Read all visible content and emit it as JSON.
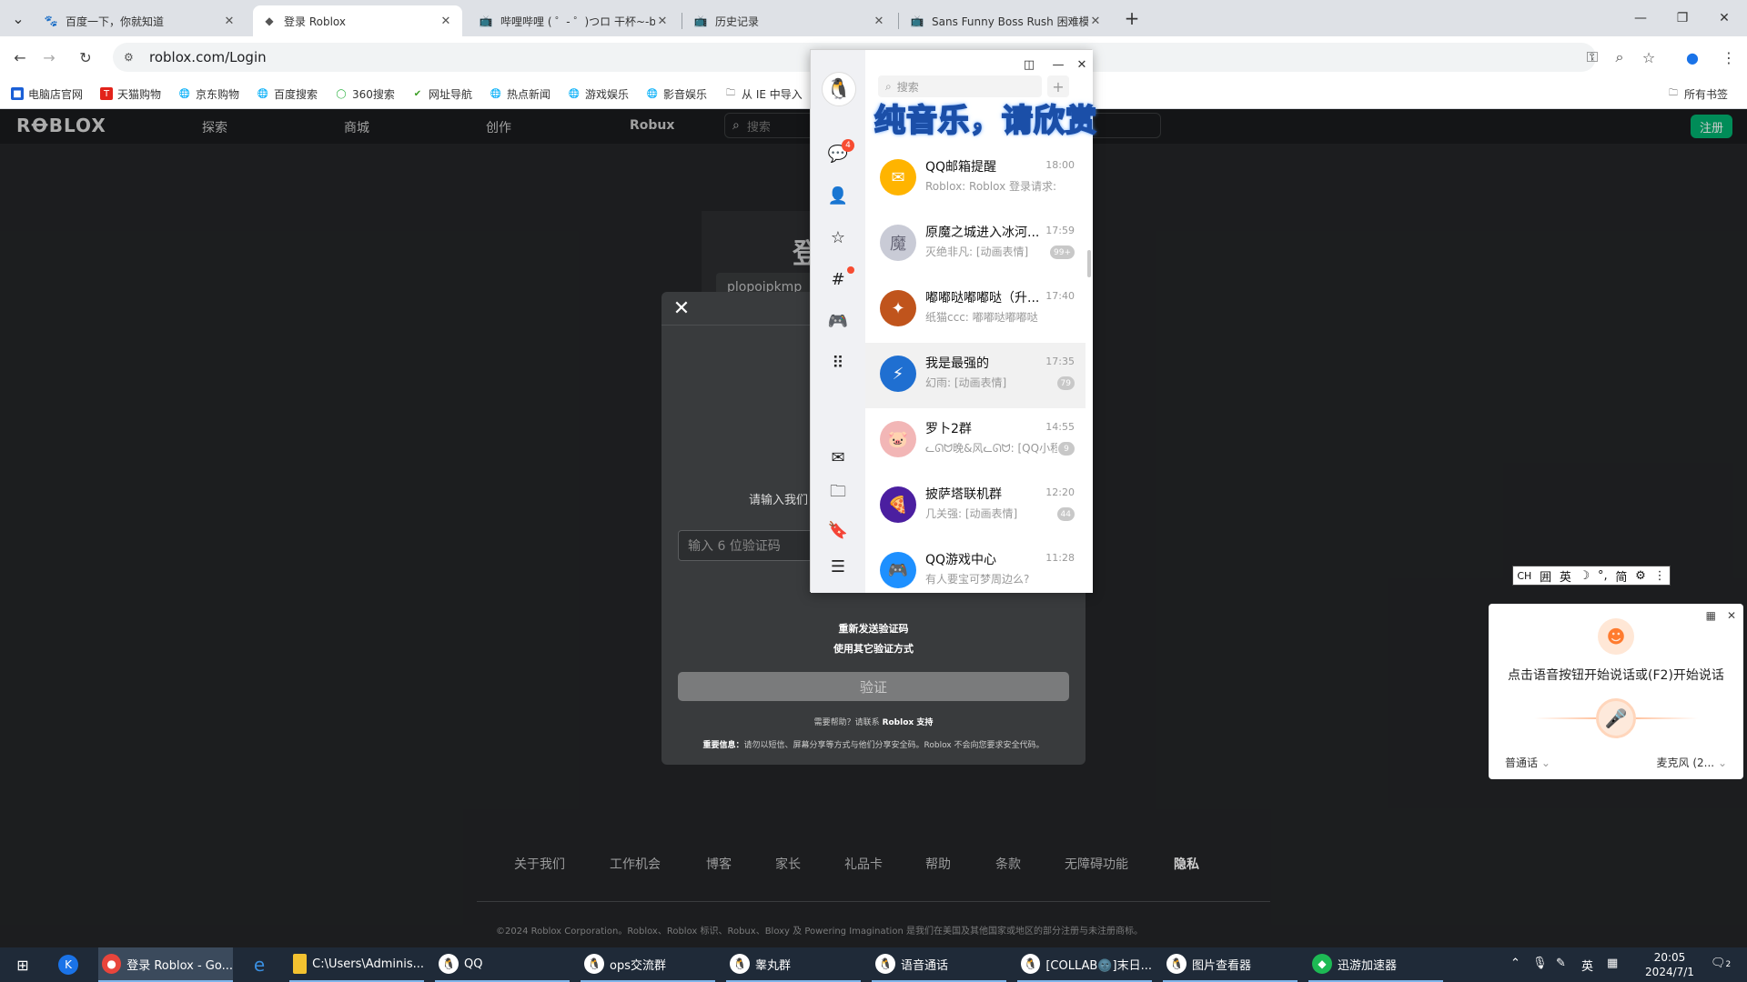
{
  "browser": {
    "tabs": [
      {
        "label": "百度一下，你就知道",
        "icon": "baidu-paw-icon",
        "active": false
      },
      {
        "label": "登录 Roblox",
        "icon": "roblox-icon",
        "active": true
      },
      {
        "label": "哔哩哔哩 ( ゜- ゜)つロ 干杯~-bili",
        "icon": "bilibili-tv-icon",
        "active": false
      },
      {
        "label": "历史记录",
        "icon": "bilibili-tv-icon",
        "active": false
      },
      {
        "label": "Sans Funny Boss Rush 困难模式",
        "icon": "bilibili-tv-icon",
        "active": false
      }
    ],
    "url": "roblox.com/Login",
    "bookmarks": [
      {
        "label": "电脑店官网",
        "color": "#1a5fd6"
      },
      {
        "label": "天猫购物",
        "color": "#e2231a"
      },
      {
        "label": "京东购物",
        "color": "#555555"
      },
      {
        "label": "百度搜索",
        "color": "#555555"
      },
      {
        "label": "360搜索",
        "color": "#2fb344"
      },
      {
        "label": "网址导航",
        "color": "#3a9d23"
      },
      {
        "label": "热点新闻",
        "color": "#555555"
      },
      {
        "label": "游戏娱乐",
        "color": "#555555"
      },
      {
        "label": "影音娱乐",
        "color": "#555555"
      },
      {
        "label": "从 IE 中导入",
        "color": "#555555"
      }
    ],
    "all_bookmarks": "所有书签"
  },
  "roblox": {
    "logo": "RꝊBLOX",
    "nav": [
      "探索",
      "商城",
      "创作",
      "Robux"
    ],
    "search_placeholder": "搜索",
    "signup": "注册",
    "login_title": "登",
    "username": "plopoipkmp",
    "verify": {
      "prompt": "请输入我们",
      "input_placeholder": "输入 6 位验证码",
      "resend": "重新发送验证码",
      "other_method": "使用其它验证方式",
      "button": "验证",
      "help_prefix": "需要帮助？请联系",
      "help_link": "Roblox 支持",
      "warning_prefix": "重要信息：",
      "warning_text": "请勿以短信、屏幕分享等方式与他们分享安全码。Roblox 不会向您要求安全代码。"
    },
    "footer": [
      "关于我们",
      "工作机会",
      "博客",
      "家长",
      "礼品卡",
      "帮助",
      "条款",
      "无障碍功能",
      "隐私"
    ],
    "copyright": "©2024 Roblox Corporation。Roblox、Roblox 标识、Robux、Bloxy 及 Powering Imagination 是我们在美国及其他国家或地区的部分注册与未注册商标。"
  },
  "qq": {
    "search_placeholder": "搜索",
    "banner": "纯音乐，请欣赏",
    "chat_badge": "4",
    "conversations": [
      {
        "name": "QQ邮箱提醒",
        "time": "18:00",
        "preview": "Roblox: Roblox 登录请求: ...",
        "badge": "",
        "avatar_color": "#ffb400",
        "avatar_icon": "mail-icon"
      },
      {
        "name": "原魔之城进入冰河...",
        "time": "17:59",
        "preview": "灭绝非凡: [动画表情]",
        "badge": "99+",
        "avatar_color": "#c9cbd6",
        "avatar_icon": "group-icon"
      },
      {
        "name": "嘟嘟哒嘟嘟哒（升...",
        "time": "17:40",
        "preview": "纸猫ccc: 嘟嘟哒嘟嘟哒",
        "badge": "",
        "avatar_color": "#c0541c",
        "avatar_icon": "group-icon"
      },
      {
        "name": "我是最强的",
        "time": "17:35",
        "preview": "幻雨: [动画表情]",
        "badge": "79",
        "avatar_color": "#1f6fd1",
        "avatar_icon": "group-icon"
      },
      {
        "name": "罗卜2群",
        "time": "14:55",
        "preview": "ᓚᘏᗢ晚&风ᓚᘏᗢ: [QQ小程...",
        "badge": "9",
        "avatar_color": "#f2b6b6",
        "avatar_icon": "pig-icon"
      },
      {
        "name": "披萨塔联机群",
        "time": "12:20",
        "preview": "几关强: [动画表情]",
        "badge": "44",
        "avatar_color": "#4b1fa0",
        "avatar_icon": "group-icon"
      },
      {
        "name": "QQ游戏中心",
        "time": "11:28",
        "preview": "有人要宝可梦周边么?",
        "badge": "",
        "avatar_color": "#1e90ff",
        "avatar_icon": "game-icon"
      }
    ]
  },
  "ime": {
    "items": [
      "CH",
      "囲",
      "英",
      "☽",
      "°,",
      "简",
      "⚙",
      "⋮"
    ]
  },
  "voice": {
    "title": "点击语音按钮开始说话或(F2)开始说话",
    "language": "普通话",
    "mic": "麦克风 (2..."
  },
  "taskbar": {
    "items": [
      {
        "label": "登录 Roblox - Go...",
        "icon_color": "#e8453c"
      },
      {
        "label": "C:\\Users\\Adminis...",
        "icon_color": "#f3c230"
      },
      {
        "label": "QQ",
        "icon_color": "#ffffff"
      },
      {
        "label": "ops交流群",
        "icon_color": "#ffffff"
      },
      {
        "label": "睾丸群",
        "icon_color": "#ffffff"
      },
      {
        "label": "语音通话",
        "icon_color": "#ffffff"
      },
      {
        "label": "[COLLAB🌚]末日...",
        "icon_color": "#ffffff"
      },
      {
        "label": "图片查看器",
        "icon_color": "#ffffff"
      },
      {
        "label": "迅游加速器",
        "icon_color": "#1db954"
      }
    ],
    "time": "20:05",
    "date": "2024/7/1",
    "ime_tray": "英",
    "notif_count": "2"
  }
}
